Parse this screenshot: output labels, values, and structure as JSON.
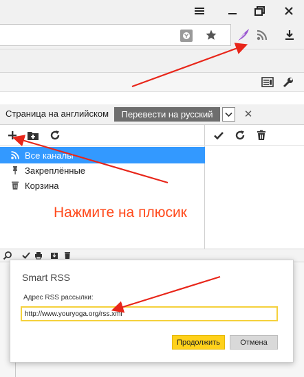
{
  "browser": {
    "icons": [
      "menu-icon",
      "restore-icon",
      "close-icon",
      "yandex-shield-icon",
      "star-icon",
      "feather-icon",
      "rss-icon",
      "download-icon",
      "reader-icon",
      "wrench-icon"
    ]
  },
  "translate_bar": {
    "label": "Страница на английском",
    "translate_button": "Перевести на русский"
  },
  "feeds": {
    "items": [
      {
        "label": "Все каналы",
        "icon": "rss-icon"
      },
      {
        "label": "Закреплённые",
        "icon": "pin-icon"
      },
      {
        "label": "Корзина",
        "icon": "trash-icon"
      }
    ]
  },
  "annotation": {
    "hint": "Нажмите на плюсик",
    "color": "#ff4a1c"
  },
  "dialog": {
    "title": "Smart RSS",
    "field_label": "Адрес RSS рассылки:",
    "field_value": "http://www.youryoga.org/rss.xml",
    "ok_label": "Продолжить",
    "cancel_label": "Отмена"
  },
  "colors": {
    "selection": "#3399ff",
    "accent_button": "#ffd11a",
    "arrow": "#e8261a"
  }
}
